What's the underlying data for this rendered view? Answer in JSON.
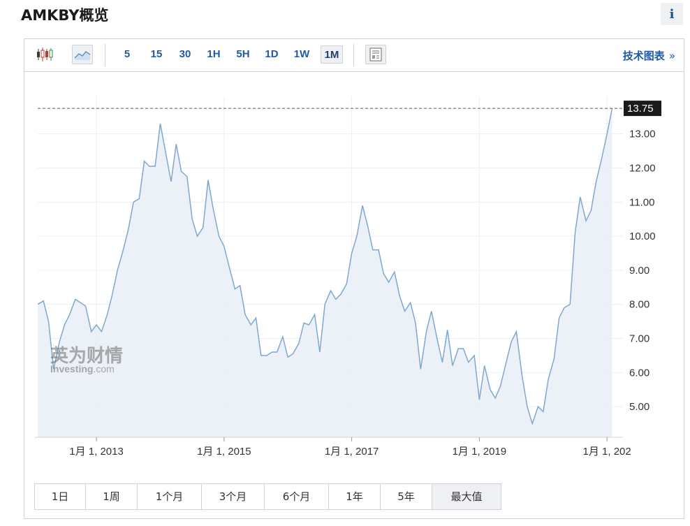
{
  "header": {
    "title": "AMKBY概览",
    "info_label": "i"
  },
  "toolbar": {
    "chart_types": [
      "candlestick-icon",
      "area-chart-icon"
    ],
    "intervals": [
      "5",
      "15",
      "30",
      "1H",
      "5H",
      "1D",
      "1W",
      "1M"
    ],
    "active_interval": "1M",
    "tech_chart_label": "技术图表",
    "tech_chart_arrow": "»"
  },
  "watermark": {
    "brand_cn": "英为财情",
    "brand_en": "Investing",
    "brand_suffix": ".com"
  },
  "range_buttons": [
    "1日",
    "1周",
    "1个月",
    "3个月",
    "6个月",
    "1年",
    "5年",
    "最大值"
  ],
  "active_range": "最大值",
  "colors": {
    "line": "#7ea7d1",
    "fill": "#e8eef6",
    "accent": "#1e5aa8",
    "last_price_bg": "#1a1a1a"
  },
  "chart_data": {
    "type": "area",
    "title": "",
    "xlabel": "",
    "ylabel": "",
    "y_ticks": [
      "5.00",
      "6.00",
      "7.00",
      "8.00",
      "9.00",
      "10.00",
      "11.00",
      "12.00",
      "13.00"
    ],
    "ylim": [
      4.1,
      14.1
    ],
    "x_range": [
      2012.08,
      2021.25
    ],
    "x_ticks": [
      {
        "x": 2013.0,
        "label": "1月 1, 2013"
      },
      {
        "x": 2015.0,
        "label": "1月 1, 2015"
      },
      {
        "x": 2017.0,
        "label": "1月 1, 2017"
      },
      {
        "x": 2019.0,
        "label": "1月 1, 2019"
      },
      {
        "x": 2021.0,
        "label": "1月 1, 202"
      }
    ],
    "last_price": "13.75",
    "last_value": 13.75,
    "grid": true,
    "series": [
      {
        "values": [
          [
            2012.08,
            8.0
          ],
          [
            2012.17,
            8.1
          ],
          [
            2012.25,
            7.5
          ],
          [
            2012.33,
            6.1
          ],
          [
            2012.42,
            6.9
          ],
          [
            2012.5,
            7.4
          ],
          [
            2012.58,
            7.7
          ],
          [
            2012.67,
            8.15
          ],
          [
            2012.75,
            8.05
          ],
          [
            2012.83,
            7.95
          ],
          [
            2012.92,
            7.2
          ],
          [
            2013.0,
            7.4
          ],
          [
            2013.08,
            7.2
          ],
          [
            2013.17,
            7.7
          ],
          [
            2013.25,
            8.3
          ],
          [
            2013.33,
            9.0
          ],
          [
            2013.42,
            9.6
          ],
          [
            2013.5,
            10.2
          ],
          [
            2013.58,
            11.0
          ],
          [
            2013.67,
            11.1
          ],
          [
            2013.75,
            12.2
          ],
          [
            2013.83,
            12.05
          ],
          [
            2013.92,
            12.05
          ],
          [
            2014.0,
            13.3
          ],
          [
            2014.08,
            12.5
          ],
          [
            2014.17,
            11.6
          ],
          [
            2014.25,
            12.7
          ],
          [
            2014.33,
            11.9
          ],
          [
            2014.42,
            11.75
          ],
          [
            2014.5,
            10.5
          ],
          [
            2014.58,
            10.0
          ],
          [
            2014.67,
            10.25
          ],
          [
            2014.75,
            11.65
          ],
          [
            2014.83,
            10.8
          ],
          [
            2014.92,
            10.0
          ],
          [
            2015.0,
            9.7
          ],
          [
            2015.08,
            9.1
          ],
          [
            2015.17,
            8.45
          ],
          [
            2015.25,
            8.55
          ],
          [
            2015.33,
            7.7
          ],
          [
            2015.42,
            7.4
          ],
          [
            2015.5,
            7.6
          ],
          [
            2015.58,
            6.5
          ],
          [
            2015.67,
            6.5
          ],
          [
            2015.75,
            6.6
          ],
          [
            2015.83,
            6.6
          ],
          [
            2015.92,
            7.05
          ],
          [
            2016.0,
            6.45
          ],
          [
            2016.08,
            6.55
          ],
          [
            2016.17,
            6.85
          ],
          [
            2016.25,
            7.45
          ],
          [
            2016.33,
            7.4
          ],
          [
            2016.42,
            7.7
          ],
          [
            2016.5,
            6.6
          ],
          [
            2016.58,
            8.0
          ],
          [
            2016.67,
            8.4
          ],
          [
            2016.75,
            8.15
          ],
          [
            2016.83,
            8.3
          ],
          [
            2016.92,
            8.6
          ],
          [
            2017.0,
            9.5
          ],
          [
            2017.08,
            10.0
          ],
          [
            2017.17,
            10.9
          ],
          [
            2017.25,
            10.3
          ],
          [
            2017.33,
            9.6
          ],
          [
            2017.42,
            9.6
          ],
          [
            2017.5,
            8.9
          ],
          [
            2017.58,
            8.65
          ],
          [
            2017.67,
            8.95
          ],
          [
            2017.75,
            8.25
          ],
          [
            2017.83,
            7.8
          ],
          [
            2017.92,
            8.05
          ],
          [
            2018.0,
            7.45
          ],
          [
            2018.08,
            6.1
          ],
          [
            2018.17,
            7.2
          ],
          [
            2018.25,
            7.8
          ],
          [
            2018.33,
            7.05
          ],
          [
            2018.42,
            6.3
          ],
          [
            2018.5,
            7.25
          ],
          [
            2018.58,
            6.2
          ],
          [
            2018.67,
            6.7
          ],
          [
            2018.75,
            6.7
          ],
          [
            2018.83,
            6.3
          ],
          [
            2018.92,
            6.5
          ],
          [
            2019.0,
            5.2
          ],
          [
            2019.08,
            6.2
          ],
          [
            2019.17,
            5.5
          ],
          [
            2019.25,
            5.25
          ],
          [
            2019.33,
            5.6
          ],
          [
            2019.42,
            6.3
          ],
          [
            2019.5,
            6.9
          ],
          [
            2019.58,
            7.2
          ],
          [
            2019.67,
            5.9
          ],
          [
            2019.75,
            5.0
          ],
          [
            2019.83,
            4.5
          ],
          [
            2019.92,
            5.0
          ],
          [
            2020.0,
            4.85
          ],
          [
            2020.08,
            5.8
          ],
          [
            2020.17,
            6.4
          ],
          [
            2020.25,
            7.6
          ],
          [
            2020.33,
            7.9
          ],
          [
            2020.42,
            8.0
          ],
          [
            2020.5,
            10.1
          ],
          [
            2020.58,
            11.15
          ],
          [
            2020.67,
            10.45
          ],
          [
            2020.75,
            10.75
          ],
          [
            2020.83,
            11.6
          ],
          [
            2020.92,
            12.3
          ],
          [
            2021.0,
            13.0
          ],
          [
            2021.08,
            13.75
          ]
        ]
      }
    ]
  }
}
